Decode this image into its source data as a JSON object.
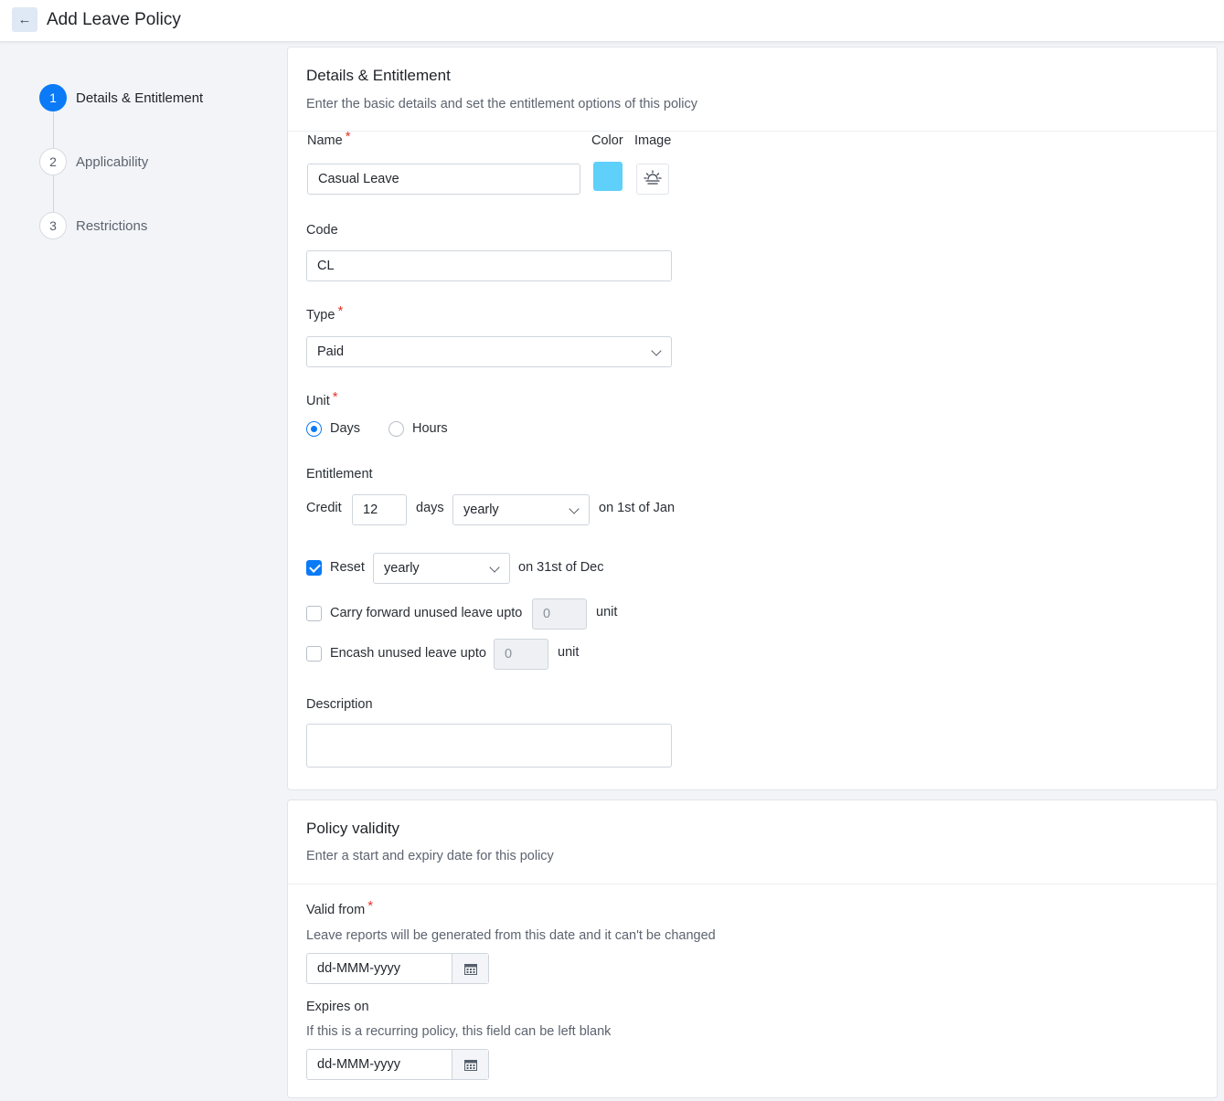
{
  "header": {
    "title": "Add Leave Policy"
  },
  "steps": [
    {
      "num": "1",
      "label": "Details & Entitlement"
    },
    {
      "num": "2",
      "label": "Applicability"
    },
    {
      "num": "3",
      "label": "Restrictions"
    }
  ],
  "details": {
    "title": "Details & Entitlement",
    "subtitle": "Enter the basic details and set the entitlement options of this policy",
    "name_label": "Name",
    "name_value": "Casual Leave",
    "color_label": "Color",
    "color_value": "#5fd0fa",
    "image_label": "Image",
    "image_icon": "sunrise-icon",
    "code_label": "Code",
    "code_value": "CL",
    "type_label": "Type",
    "type_value": "Paid",
    "unit_label": "Unit",
    "unit_options": [
      "Days",
      "Hours"
    ],
    "unit_selected": "Days",
    "entitlement_label": "Entitlement",
    "credit_label": "Credit",
    "credit_value": "12",
    "credit_unit": "days",
    "credit_frequency": "yearly",
    "credit_on": "on 1st of Jan",
    "reset_label": "Reset",
    "reset_checked": true,
    "reset_frequency": "yearly",
    "reset_on": "on 31st of Dec",
    "carry_label": "Carry forward unused leave upto",
    "carry_checked": false,
    "carry_value": "0",
    "carry_unit": "unit",
    "encash_label": "Encash unused leave upto",
    "encash_checked": false,
    "encash_value": "0",
    "encash_unit": "unit",
    "description_label": "Description",
    "description_value": ""
  },
  "validity": {
    "title": "Policy validity",
    "subtitle": "Enter a start and expiry date for this policy",
    "from_label": "Valid from",
    "from_hint": "Leave reports will be generated from this date and it can't be changed",
    "from_placeholder": "dd-MMM-yyyy",
    "expires_label": "Expires on",
    "expires_hint": "If this is a recurring policy, this field can be left blank",
    "expires_placeholder": "dd-MMM-yyyy"
  },
  "colors": {
    "accent": "#0a7af7",
    "required": "#e5342d"
  }
}
